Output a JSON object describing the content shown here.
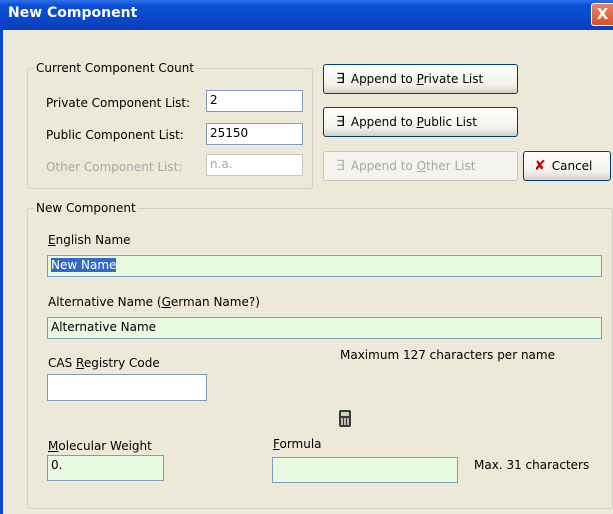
{
  "window": {
    "title": "New Component",
    "close_glyph": "X"
  },
  "current_count": {
    "legend": "Current Component Count",
    "private_label": "Private Component List:",
    "private_value": "2",
    "public_label": "Public Component List:",
    "public_value": "25150",
    "other_label": "Other Component List:",
    "other_value": "n.a."
  },
  "buttons": {
    "append_private": {
      "pre": "Append to ",
      "key": "P",
      "post": "rivate List"
    },
    "append_public": {
      "pre": "Append to ",
      "key": "P",
      "post": "ublic List"
    },
    "append_other": {
      "pre": "Append to ",
      "key": "O",
      "post": "ther List"
    },
    "cancel": "Cancel",
    "append_icon": "∃",
    "cancel_icon": "✘"
  },
  "new_component": {
    "legend": "New Component",
    "english_label_key": "E",
    "english_label_rest": "nglish Name",
    "english_value": "New Name",
    "alt_label_pre": "Alternative Name (",
    "alt_label_key": "G",
    "alt_label_post": "erman Name?)",
    "alt_value": "Alternative Name",
    "cas_label_pre": "CAS ",
    "cas_label_key": "R",
    "cas_label_post": "egistry Code",
    "cas_value": "",
    "max_name_note": "Maximum 127 characters per name",
    "mw_label_key": "M",
    "mw_label_rest": "olecular Weight",
    "mw_value": "0.",
    "formula_label_key": "F",
    "formula_label_rest": "ormula",
    "formula_value": "",
    "max_formula_note": "Max. 31 characters"
  },
  "colors": {
    "titlebar": "#0a48cb",
    "dialog_bg": "#ece9d8",
    "input_green": "#e8fae0",
    "selection": "#316ac5",
    "cancel_icon": "#cc0000"
  }
}
